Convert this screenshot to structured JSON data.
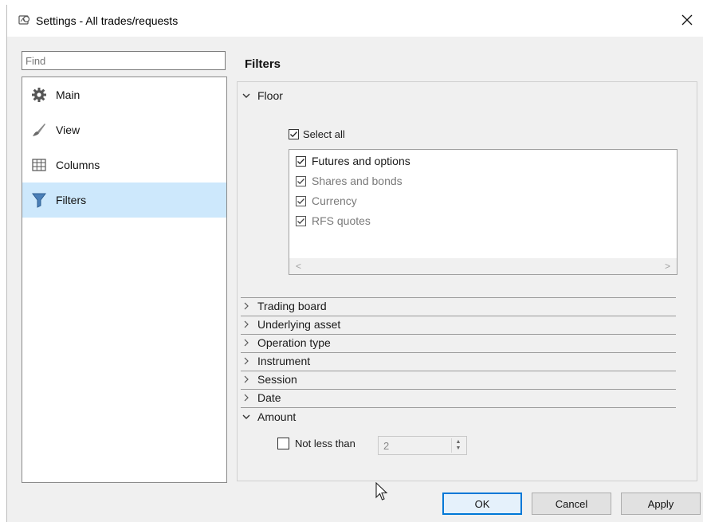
{
  "window": {
    "title": "Settings - All trades/requests",
    "title_icon": "settings-window-icon",
    "close_icon": "close-icon"
  },
  "search": {
    "placeholder": "Find",
    "value": ""
  },
  "nav": {
    "items": [
      {
        "label": "Main",
        "icon": "gear-icon",
        "selected": false
      },
      {
        "label": "View",
        "icon": "brush-icon",
        "selected": false
      },
      {
        "label": "Columns",
        "icon": "columns-icon",
        "selected": false
      },
      {
        "label": "Filters",
        "icon": "filter-icon",
        "selected": true
      }
    ]
  },
  "main": {
    "section_title": "Filters",
    "floor": {
      "label": "Floor",
      "expanded": true,
      "select_all": {
        "label": "Select all",
        "checked": true
      },
      "items": [
        {
          "label": "Futures and options",
          "checked": true,
          "enabled": true
        },
        {
          "label": "Shares and bonds",
          "checked": true,
          "enabled": false
        },
        {
          "label": "Currency",
          "checked": true,
          "enabled": false
        },
        {
          "label": "RFS quotes",
          "checked": true,
          "enabled": false
        }
      ],
      "scroll_left": "<",
      "scroll_right": ">"
    },
    "collapsed_groups": [
      {
        "label": "Trading board"
      },
      {
        "label": "Underlying asset"
      },
      {
        "label": "Operation type"
      },
      {
        "label": "Instrument"
      },
      {
        "label": "Session"
      },
      {
        "label": "Date"
      }
    ],
    "amount": {
      "label": "Amount",
      "expanded": true,
      "not_less_than": {
        "label": "Not less than",
        "checked": false
      },
      "value": "2"
    }
  },
  "footer": {
    "ok_label": "OK",
    "cancel_label": "Cancel",
    "apply_label": "Apply"
  },
  "colors": {
    "selection": "#cde8fc",
    "accent": "#0078d7",
    "dialog_bg": "#f0f0f0"
  }
}
